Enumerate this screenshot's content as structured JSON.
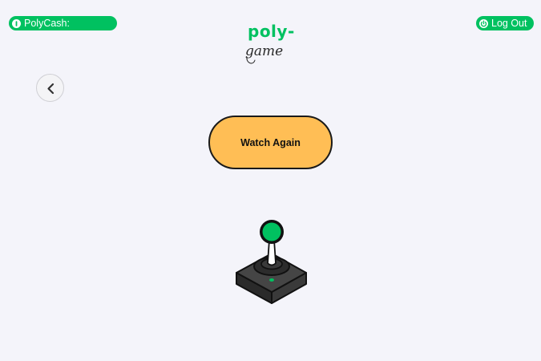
{
  "header": {
    "polycash_label": "PolyCash:",
    "logout_label": "Log Out",
    "polycash_icon": "info-circle-icon",
    "logout_icon": "power-icon"
  },
  "logo": {
    "line1": "poly-",
    "line2": "game"
  },
  "navigation": {
    "back_icon": "chevron-left-icon"
  },
  "main": {
    "watch_again_label": "Watch Again",
    "illustration": "joystick-icon"
  },
  "colors": {
    "background": "#f4f4fa",
    "brand_green": "#00c160",
    "button_orange": "#ffbe55",
    "outline": "#1a1a1a"
  }
}
